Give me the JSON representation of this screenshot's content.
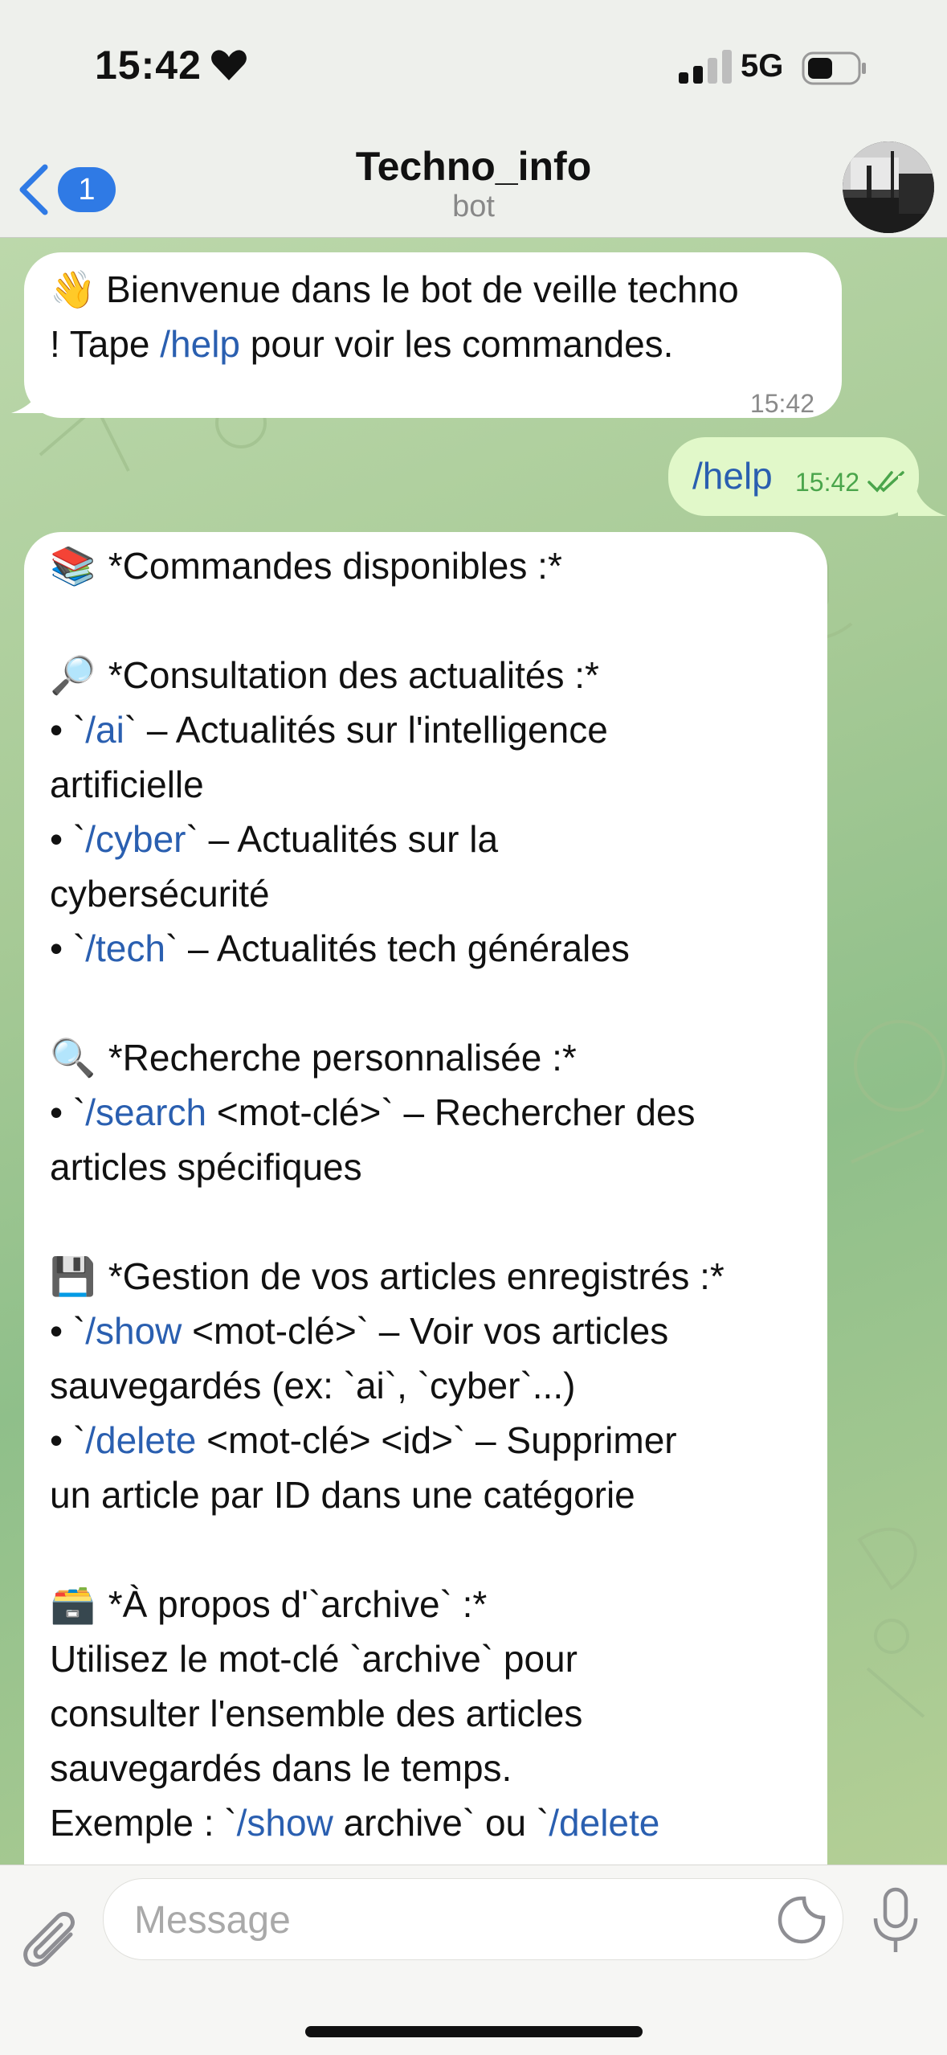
{
  "status_bar": {
    "time": "15:42",
    "network": "5G",
    "heart_icon": "heart-icon",
    "signal_icon": "signal-bars-icon",
    "battery_icon": "battery-icon"
  },
  "header": {
    "back_badge": "1",
    "title": "Techno_info",
    "subtitle": "bot",
    "back_icon": "chevron-left-icon",
    "avatar": "bot-avatar"
  },
  "messages": [
    {
      "from": "bot",
      "time": "15:42",
      "lines": [
        [
          {
            "t": "👋 Bienvenue dans le bot de veille techno"
          }
        ],
        [
          {
            "t": "! Tape "
          },
          {
            "t": "/help",
            "cmd": true
          },
          {
            "t": " pour voir les commandes."
          }
        ]
      ]
    },
    {
      "from": "me",
      "text": "/help",
      "time": "15:42",
      "status": "double-check-icon"
    },
    {
      "from": "bot",
      "lines": [
        [
          {
            "t": "📚",
            "e": true
          },
          {
            "t": " *Commandes disponibles :*"
          }
        ],
        [
          {
            "t": " "
          }
        ],
        [
          {
            "t": "🔎",
            "e": true
          },
          {
            "t": " *Consultation des actualités :*"
          }
        ],
        [
          {
            "t": "• `"
          },
          {
            "t": "/ai",
            "cmd": true
          },
          {
            "t": "` – Actualités sur l'intelligence"
          }
        ],
        [
          {
            "t": "artificielle"
          }
        ],
        [
          {
            "t": "• `"
          },
          {
            "t": "/cyber",
            "cmd": true
          },
          {
            "t": "` – Actualités sur la"
          }
        ],
        [
          {
            "t": "cybersécurité"
          }
        ],
        [
          {
            "t": "• `"
          },
          {
            "t": "/tech",
            "cmd": true
          },
          {
            "t": "` – Actualités tech générales"
          }
        ],
        [
          {
            "t": " "
          }
        ],
        [
          {
            "t": "🔍",
            "e": true
          },
          {
            "t": " *Recherche personnalisée :*"
          }
        ],
        [
          {
            "t": "• `"
          },
          {
            "t": "/search",
            "cmd": true
          },
          {
            "t": " <mot-clé>` – Rechercher des"
          }
        ],
        [
          {
            "t": "articles spécifiques"
          }
        ],
        [
          {
            "t": " "
          }
        ],
        [
          {
            "t": "💾",
            "e": true
          },
          {
            "t": " *Gestion de vos articles enregistrés :*"
          }
        ],
        [
          {
            "t": "• `"
          },
          {
            "t": "/show",
            "cmd": true
          },
          {
            "t": " <mot-clé>` – Voir vos articles"
          }
        ],
        [
          {
            "t": "sauvegardés (ex: `ai`, `cyber`...)"
          }
        ],
        [
          {
            "t": "• `"
          },
          {
            "t": "/delete",
            "cmd": true
          },
          {
            "t": " <mot-clé> <id>` – Supprimer"
          }
        ],
        [
          {
            "t": "un article par ID dans une catégorie"
          }
        ],
        [
          {
            "t": " "
          }
        ],
        [
          {
            "t": "🗃️",
            "e": true
          },
          {
            "t": " *À propos d'`archive` :*"
          }
        ],
        [
          {
            "t": "Utilisez le mot-clé `archive` pour"
          }
        ],
        [
          {
            "t": "consulter l'ensemble des articles"
          }
        ],
        [
          {
            "t": "sauvegardés dans le temps."
          }
        ],
        [
          {
            "t": "Exemple : `"
          },
          {
            "t": "/show",
            "cmd": true
          },
          {
            "t": " archive` ou `"
          },
          {
            "t": "/delete",
            "cmd": true
          }
        ]
      ]
    }
  ],
  "input": {
    "placeholder": "Message",
    "attach_icon": "paperclip-icon",
    "sticker_icon": "sticker-icon",
    "mic_icon": "microphone-icon"
  },
  "colors": {
    "command_link": "#2a5fb0",
    "outgoing_bubble": "#e1f8c9",
    "badge": "#2f7ae5",
    "read_check": "#4aa54b"
  }
}
